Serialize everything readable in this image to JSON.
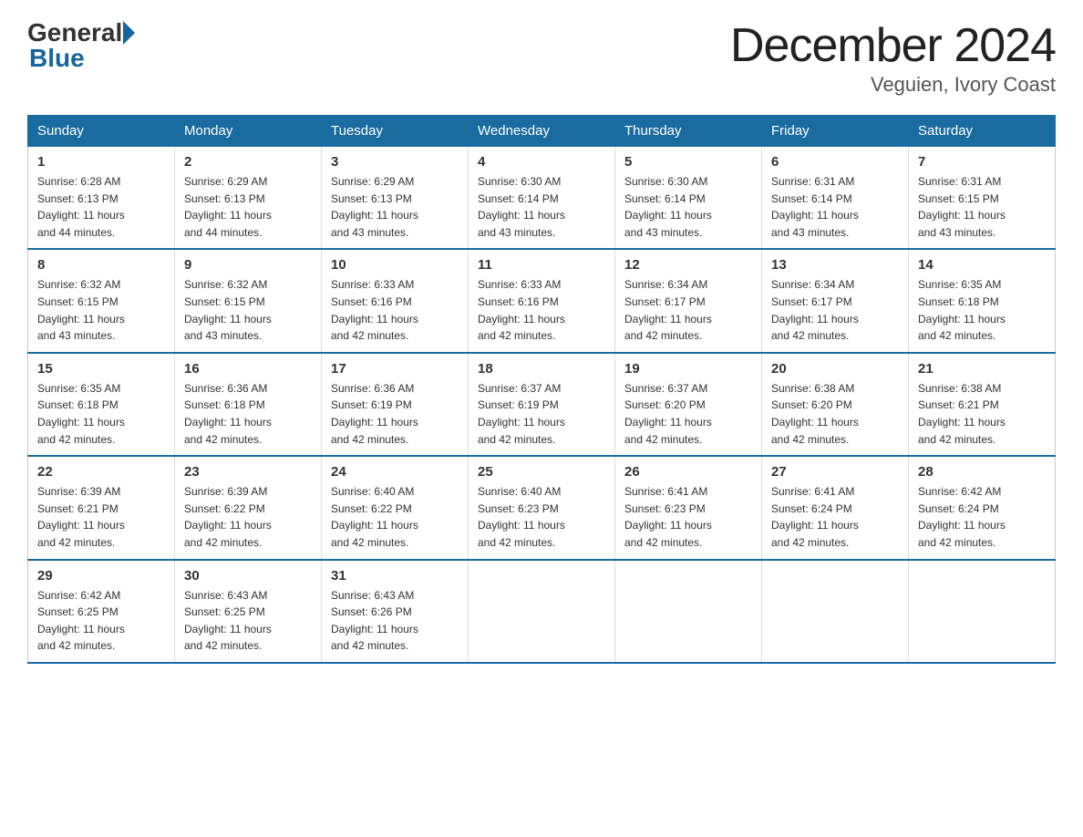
{
  "logo": {
    "general": "General",
    "blue": "Blue"
  },
  "header": {
    "month_year": "December 2024",
    "location": "Veguien, Ivory Coast"
  },
  "days_of_week": [
    "Sunday",
    "Monday",
    "Tuesday",
    "Wednesday",
    "Thursday",
    "Friday",
    "Saturday"
  ],
  "weeks": [
    [
      {
        "day": "1",
        "sunrise": "6:28 AM",
        "sunset": "6:13 PM",
        "daylight": "11 hours and 44 minutes."
      },
      {
        "day": "2",
        "sunrise": "6:29 AM",
        "sunset": "6:13 PM",
        "daylight": "11 hours and 44 minutes."
      },
      {
        "day": "3",
        "sunrise": "6:29 AM",
        "sunset": "6:13 PM",
        "daylight": "11 hours and 43 minutes."
      },
      {
        "day": "4",
        "sunrise": "6:30 AM",
        "sunset": "6:14 PM",
        "daylight": "11 hours and 43 minutes."
      },
      {
        "day": "5",
        "sunrise": "6:30 AM",
        "sunset": "6:14 PM",
        "daylight": "11 hours and 43 minutes."
      },
      {
        "day": "6",
        "sunrise": "6:31 AM",
        "sunset": "6:14 PM",
        "daylight": "11 hours and 43 minutes."
      },
      {
        "day": "7",
        "sunrise": "6:31 AM",
        "sunset": "6:15 PM",
        "daylight": "11 hours and 43 minutes."
      }
    ],
    [
      {
        "day": "8",
        "sunrise": "6:32 AM",
        "sunset": "6:15 PM",
        "daylight": "11 hours and 43 minutes."
      },
      {
        "day": "9",
        "sunrise": "6:32 AM",
        "sunset": "6:15 PM",
        "daylight": "11 hours and 43 minutes."
      },
      {
        "day": "10",
        "sunrise": "6:33 AM",
        "sunset": "6:16 PM",
        "daylight": "11 hours and 42 minutes."
      },
      {
        "day": "11",
        "sunrise": "6:33 AM",
        "sunset": "6:16 PM",
        "daylight": "11 hours and 42 minutes."
      },
      {
        "day": "12",
        "sunrise": "6:34 AM",
        "sunset": "6:17 PM",
        "daylight": "11 hours and 42 minutes."
      },
      {
        "day": "13",
        "sunrise": "6:34 AM",
        "sunset": "6:17 PM",
        "daylight": "11 hours and 42 minutes."
      },
      {
        "day": "14",
        "sunrise": "6:35 AM",
        "sunset": "6:18 PM",
        "daylight": "11 hours and 42 minutes."
      }
    ],
    [
      {
        "day": "15",
        "sunrise": "6:35 AM",
        "sunset": "6:18 PM",
        "daylight": "11 hours and 42 minutes."
      },
      {
        "day": "16",
        "sunrise": "6:36 AM",
        "sunset": "6:18 PM",
        "daylight": "11 hours and 42 minutes."
      },
      {
        "day": "17",
        "sunrise": "6:36 AM",
        "sunset": "6:19 PM",
        "daylight": "11 hours and 42 minutes."
      },
      {
        "day": "18",
        "sunrise": "6:37 AM",
        "sunset": "6:19 PM",
        "daylight": "11 hours and 42 minutes."
      },
      {
        "day": "19",
        "sunrise": "6:37 AM",
        "sunset": "6:20 PM",
        "daylight": "11 hours and 42 minutes."
      },
      {
        "day": "20",
        "sunrise": "6:38 AM",
        "sunset": "6:20 PM",
        "daylight": "11 hours and 42 minutes."
      },
      {
        "day": "21",
        "sunrise": "6:38 AM",
        "sunset": "6:21 PM",
        "daylight": "11 hours and 42 minutes."
      }
    ],
    [
      {
        "day": "22",
        "sunrise": "6:39 AM",
        "sunset": "6:21 PM",
        "daylight": "11 hours and 42 minutes."
      },
      {
        "day": "23",
        "sunrise": "6:39 AM",
        "sunset": "6:22 PM",
        "daylight": "11 hours and 42 minutes."
      },
      {
        "day": "24",
        "sunrise": "6:40 AM",
        "sunset": "6:22 PM",
        "daylight": "11 hours and 42 minutes."
      },
      {
        "day": "25",
        "sunrise": "6:40 AM",
        "sunset": "6:23 PM",
        "daylight": "11 hours and 42 minutes."
      },
      {
        "day": "26",
        "sunrise": "6:41 AM",
        "sunset": "6:23 PM",
        "daylight": "11 hours and 42 minutes."
      },
      {
        "day": "27",
        "sunrise": "6:41 AM",
        "sunset": "6:24 PM",
        "daylight": "11 hours and 42 minutes."
      },
      {
        "day": "28",
        "sunrise": "6:42 AM",
        "sunset": "6:24 PM",
        "daylight": "11 hours and 42 minutes."
      }
    ],
    [
      {
        "day": "29",
        "sunrise": "6:42 AM",
        "sunset": "6:25 PM",
        "daylight": "11 hours and 42 minutes."
      },
      {
        "day": "30",
        "sunrise": "6:43 AM",
        "sunset": "6:25 PM",
        "daylight": "11 hours and 42 minutes."
      },
      {
        "day": "31",
        "sunrise": "6:43 AM",
        "sunset": "6:26 PM",
        "daylight": "11 hours and 42 minutes."
      },
      null,
      null,
      null,
      null
    ]
  ],
  "labels": {
    "sunrise": "Sunrise:",
    "sunset": "Sunset:",
    "daylight": "Daylight:"
  }
}
